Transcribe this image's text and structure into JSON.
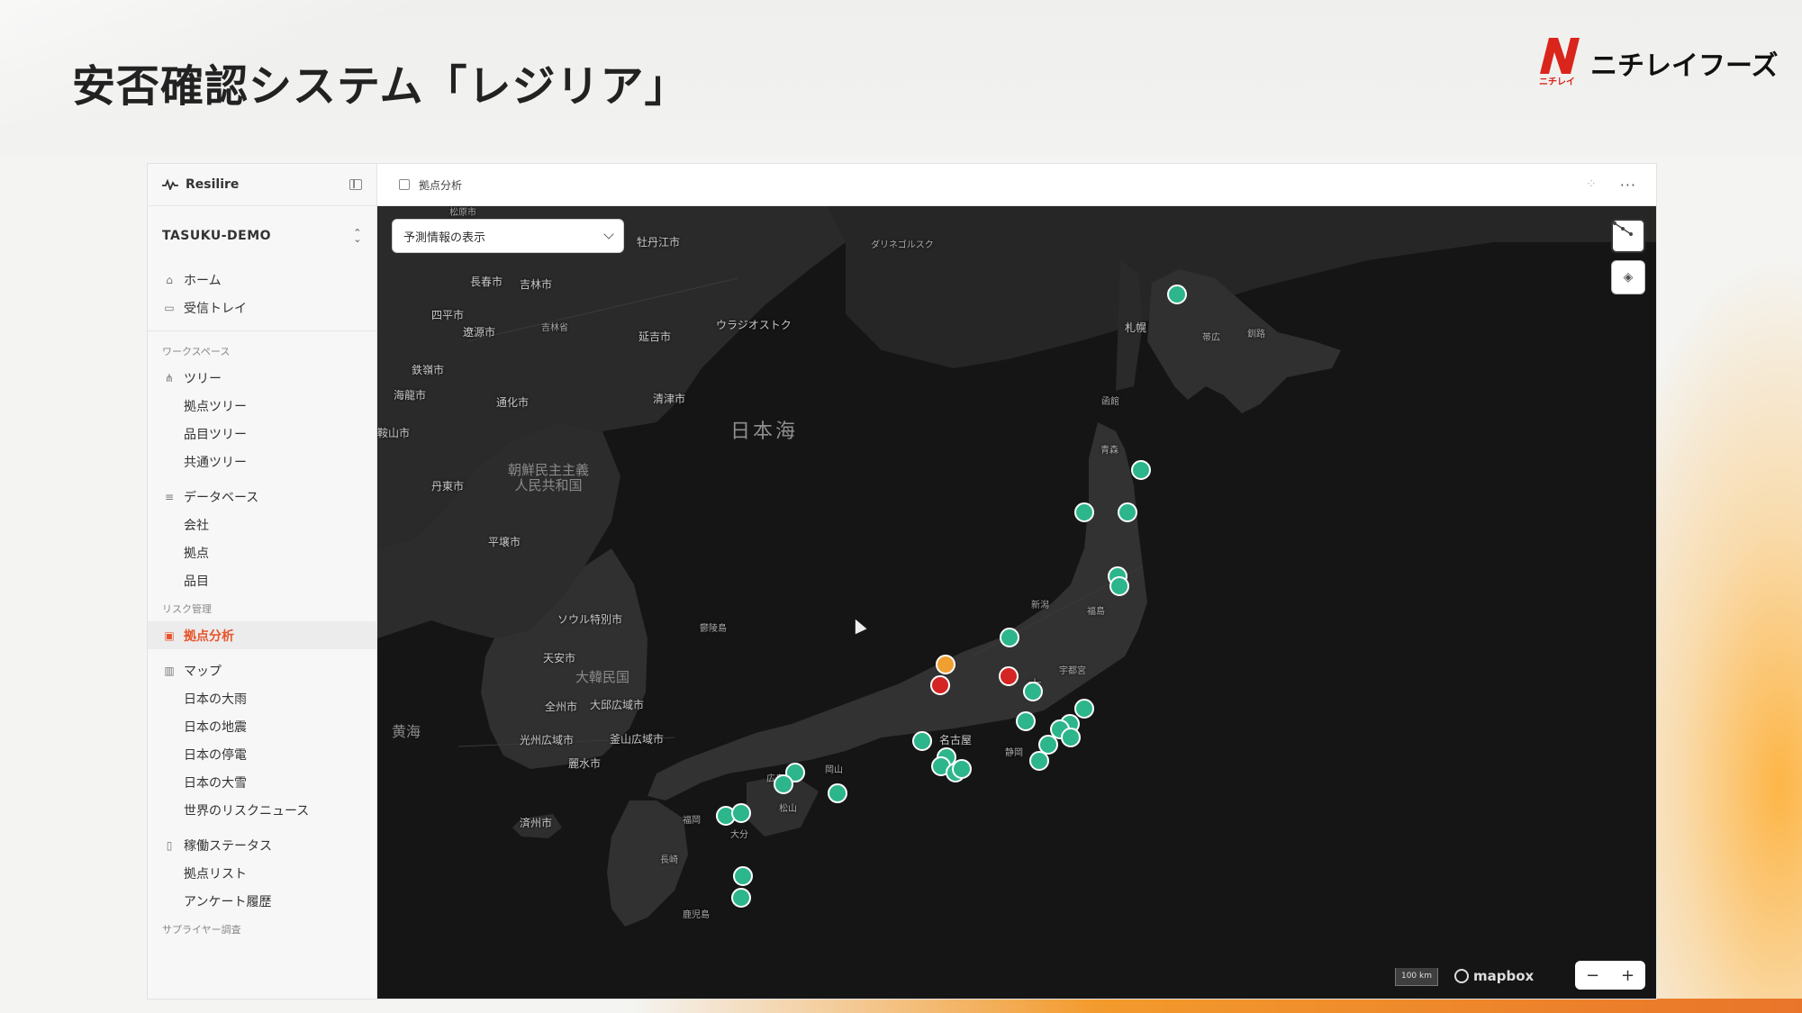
{
  "slide": {
    "title": "安否確認システム「レジリア」",
    "logo_text": "ニチレイフーズ",
    "logo_small": "ニチレイ"
  },
  "app": {
    "brand": "Resilire",
    "workspace": "TASUKU-DEMO",
    "tab_title": "拠点分析",
    "nav": {
      "home": "ホーム",
      "inbox": "受信トレイ",
      "workspace_section": "ワークスペース",
      "tree": "ツリー",
      "tree_items": [
        "拠点ツリー",
        "品目ツリー",
        "共通ツリー"
      ],
      "database": "データベース",
      "database_items": [
        "会社",
        "拠点",
        "品目"
      ],
      "risk_section": "リスク管理",
      "site_analysis": "拠点分析",
      "map": "マップ",
      "map_items": [
        "日本の大雨",
        "日本の地震",
        "日本の停電",
        "日本の大雪",
        "世界のリスクニュース"
      ],
      "operation_status": "稼働ステータス",
      "operation_items": [
        "拠点リスト",
        "アンケート履歴"
      ],
      "supplier_section": "サプライヤー調査"
    }
  },
  "map": {
    "dropdown_value": "予測情報の表示",
    "scale_label": "100 km",
    "attribution": "mapbox",
    "zoom_out": "−",
    "zoom_in": "+",
    "colors": {
      "normal": "#2db58b",
      "warning": "#f0a030",
      "alert": "#d42424"
    },
    "labels": {
      "japan_sea": "日本海",
      "yellow_sea": "黄海",
      "korea": "大韓民国",
      "dprk": "朝鮮民主主義\n人民共和国",
      "seoul": "ソウル特別市",
      "pyongyang": "平壌市",
      "busan": "釜山広域市",
      "daegu": "大邱広域市",
      "gwangju": "光州広域市",
      "jeonju": "全州市",
      "cheonan": "天安市",
      "jeju": "済州市",
      "yeosu": "麗水市",
      "dandong": "丹東市",
      "changchun": "長春市",
      "jilin": "吉林市",
      "jilin_prov": "吉林省",
      "siping": "四平市",
      "liaoyuan": "遼源市",
      "tieling": "鉄嶺市",
      "tonghua": "通化市",
      "meihekou": "海龍市",
      "anshan": "鞍山市",
      "yanji": "延吉市",
      "qingjin": "清津市",
      "vladivostok": "ウラジオストク",
      "mudanjiang": "牡丹江市",
      "songyuan": "松原市",
      "dalnegorsk": "ダリネゴルスク",
      "ulleung": "鬱陵島",
      "sapporo": "札幌",
      "obihiro": "帯広",
      "kushiro": "釧路",
      "hakodate": "函館",
      "aomori": "青森",
      "niigata": "新潟",
      "fukushima": "福島",
      "utsunomiya": "宇都宮",
      "nagoya": "名古屋",
      "shizuoka": "静岡",
      "okayama": "岡山",
      "matsuyama": "松山",
      "oita": "大分",
      "nagasaki": "長崎",
      "kagoshima": "鹿児島",
      "fukuoka": "福岡",
      "hiroshima": "広島",
      "japan": "本"
    },
    "markers": [
      {
        "status": "normal"
      },
      {
        "status": "normal"
      },
      {
        "status": "normal"
      },
      {
        "status": "normal"
      },
      {
        "status": "normal"
      },
      {
        "status": "normal"
      },
      {
        "status": "normal"
      },
      {
        "status": "warning"
      },
      {
        "status": "alert"
      },
      {
        "status": "alert"
      },
      {
        "status": "normal"
      },
      {
        "status": "normal"
      },
      {
        "status": "normal"
      },
      {
        "status": "normal"
      },
      {
        "status": "normal"
      },
      {
        "status": "normal"
      },
      {
        "status": "normal"
      },
      {
        "status": "normal"
      },
      {
        "status": "normal"
      },
      {
        "status": "normal"
      },
      {
        "status": "normal"
      },
      {
        "status": "normal"
      },
      {
        "status": "normal"
      },
      {
        "status": "normal"
      },
      {
        "status": "normal"
      },
      {
        "status": "normal"
      },
      {
        "status": "normal"
      },
      {
        "status": "normal"
      },
      {
        "status": "normal"
      },
      {
        "status": "normal"
      }
    ]
  }
}
